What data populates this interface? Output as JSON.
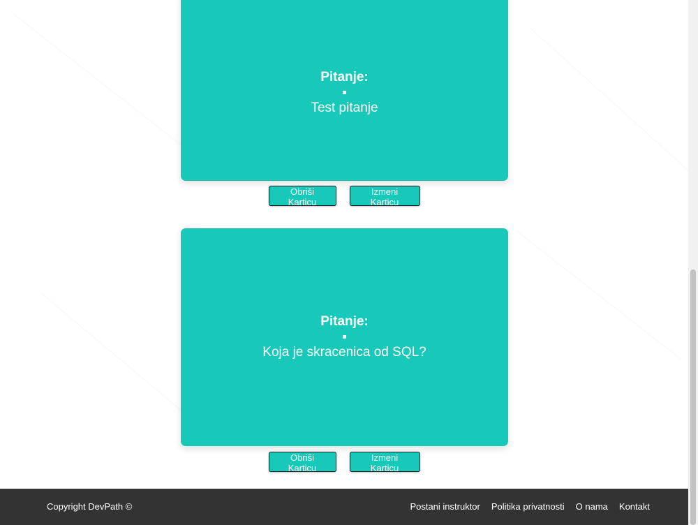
{
  "cards": [
    {
      "title": "Pitanje:",
      "question": "Test pitanje",
      "delete_label": "Obriši Karticu",
      "edit_label": "Izmeni Karticu"
    },
    {
      "title": "Pitanje:",
      "question": "Koja je skracenica od SQL?",
      "delete_label": "Obriši Karticu",
      "edit_label": "Izmeni Karticu"
    }
  ],
  "footer": {
    "copyright": "Copyright DevPath ©",
    "links": [
      "Postani instruktor",
      "Politika privatnosti",
      "O nama",
      "Kontakt"
    ]
  },
  "colors": {
    "card": "#18c9b9",
    "footer": "#333333"
  }
}
